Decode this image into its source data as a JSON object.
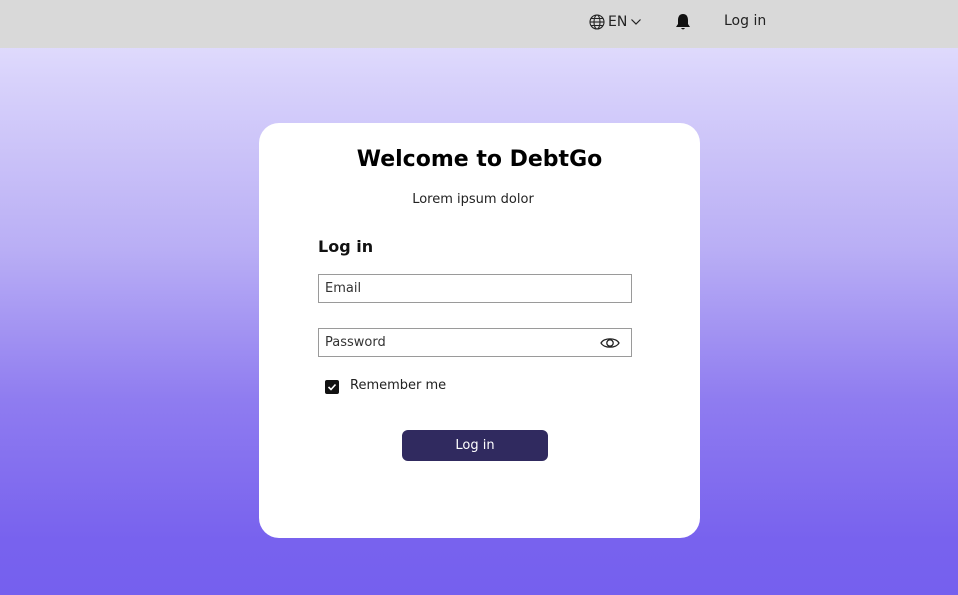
{
  "topbar": {
    "language": "EN",
    "login_link": "Log in",
    "icons": [
      "globe-icon",
      "chevron-down-icon",
      "bell-icon"
    ]
  },
  "card": {
    "title": "Welcome to DebtGo",
    "subtitle": "Lorem ipsum dolor",
    "section_title": "Log in",
    "email": {
      "value": "",
      "placeholder": "Email"
    },
    "password": {
      "value": "",
      "placeholder": "Password"
    },
    "remember_label": "Remember me",
    "remember_checked": true,
    "login_button": "Log in"
  },
  "colors": {
    "topbar_bg": "#d9d9d9",
    "button_bg": "#302a5f",
    "gradient_top": "#e9e6ff",
    "gradient_bottom": "#7560ee"
  }
}
